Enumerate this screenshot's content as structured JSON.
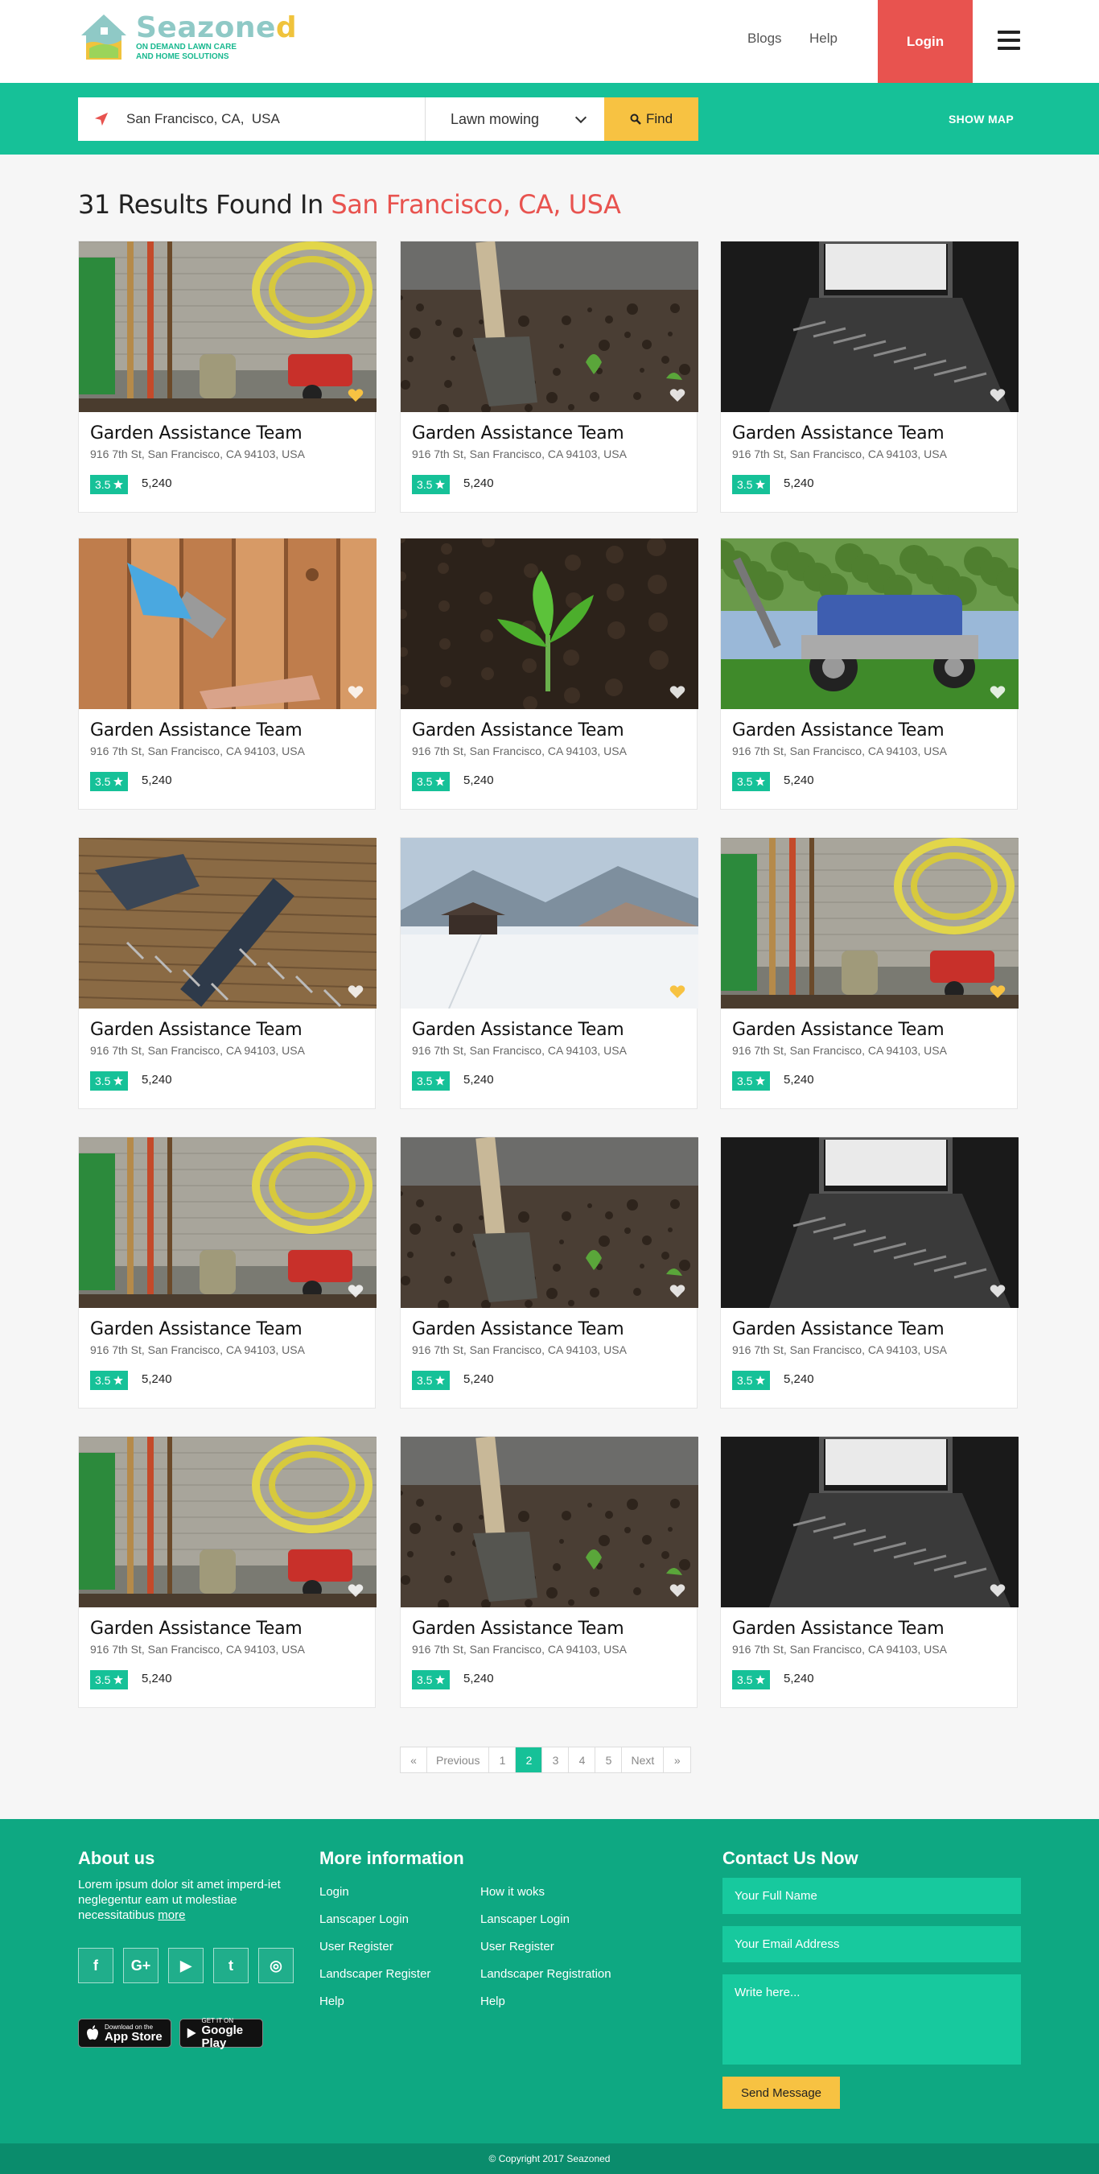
{
  "colors": {
    "brand": "#16c198",
    "accent_red": "#e8534f",
    "accent_yellow": "#f7c242",
    "footer_bg": "#0ea882"
  },
  "header": {
    "logo": {
      "name_main": "Seazone",
      "name_accent": "d",
      "tagline_1": "ON DEMAND LAWN CARE",
      "tagline_2": "AND HOME SOLUTIONS"
    },
    "nav": [
      "Blogs",
      "Help"
    ],
    "login_label": "Login",
    "menu_icon": "hamburger-icon"
  },
  "search": {
    "location_value": "San Francisco, CA,  USA",
    "location_icon": "location-arrow-icon",
    "service_value": "Lawn mowing",
    "find_label": "Find",
    "show_map_label": "SHOW MAP"
  },
  "results": {
    "prefix": "31 Results Found In",
    "city": "San Francisco, CA,  USA"
  },
  "cards": [
    {
      "title": "Garden Assistance Team",
      "address": "916 7th St, San Francisco, CA 94103, USA",
      "rating": "3.5",
      "reviews": "5,240",
      "image": "garden-tools",
      "favorite": true
    },
    {
      "title": "Garden Assistance Team",
      "address": "916 7th St, San Francisco, CA 94103, USA",
      "rating": "3.5",
      "reviews": "5,240",
      "image": "shovel-soil",
      "favorite": false
    },
    {
      "title": "Garden Assistance Team",
      "address": "916 7th St, San Francisco, CA 94103, USA",
      "rating": "3.5",
      "reviews": "5,240",
      "image": "dark-window-tools",
      "favorite": false
    },
    {
      "title": "Garden Assistance Team",
      "address": "916 7th St, San Francisco, CA 94103, USA",
      "rating": "3.5",
      "reviews": "5,240",
      "image": "paint-brush-wood",
      "favorite": false
    },
    {
      "title": "Garden Assistance Team",
      "address": "916 7th St, San Francisco, CA 94103, USA",
      "rating": "3.5",
      "reviews": "5,240",
      "image": "sprout-soil",
      "favorite": false
    },
    {
      "title": "Garden Assistance Team",
      "address": "916 7th St, San Francisco, CA 94103, USA",
      "rating": "3.5",
      "reviews": "5,240",
      "image": "lawn-mower",
      "favorite": false
    },
    {
      "title": "Garden Assistance Team",
      "address": "916 7th St, San Francisco, CA 94103, USA",
      "rating": "3.5",
      "reviews": "5,240",
      "image": "hammer-nails",
      "favorite": false
    },
    {
      "title": "Garden Assistance Team",
      "address": "916 7th St, San Francisco, CA 94103, USA",
      "rating": "3.5",
      "reviews": "5,240",
      "image": "snow-cabin",
      "favorite": true
    },
    {
      "title": "Garden Assistance Team",
      "address": "916 7th St, San Francisco, CA 94103, USA",
      "rating": "3.5",
      "reviews": "5,240",
      "image": "garden-tools",
      "favorite": true
    },
    {
      "title": "Garden Assistance Team",
      "address": "916 7th St, San Francisco, CA 94103, USA",
      "rating": "3.5",
      "reviews": "5,240",
      "image": "garden-tools",
      "favorite": false
    },
    {
      "title": "Garden Assistance Team",
      "address": "916 7th St, San Francisco, CA 94103, USA",
      "rating": "3.5",
      "reviews": "5,240",
      "image": "shovel-soil",
      "favorite": false
    },
    {
      "title": "Garden Assistance Team",
      "address": "916 7th St, San Francisco, CA 94103, USA",
      "rating": "3.5",
      "reviews": "5,240",
      "image": "dark-window-tools",
      "favorite": false
    },
    {
      "title": "Garden Assistance Team",
      "address": "916 7th St, San Francisco, CA 94103, USA",
      "rating": "3.5",
      "reviews": "5,240",
      "image": "garden-tools",
      "favorite": false
    },
    {
      "title": "Garden Assistance Team",
      "address": "916 7th St, San Francisco, CA 94103, USA",
      "rating": "3.5",
      "reviews": "5,240",
      "image": "shovel-soil",
      "favorite": false
    },
    {
      "title": "Garden Assistance Team",
      "address": "916 7th St, San Francisco, CA 94103, USA",
      "rating": "3.5",
      "reviews": "5,240",
      "image": "dark-window-tools",
      "favorite": false
    }
  ],
  "pagination": {
    "first": "«",
    "previous": "Previous",
    "pages": [
      "1",
      "2",
      "3",
      "4",
      "5"
    ],
    "current": "2",
    "next": "Next",
    "last": "»"
  },
  "footer": {
    "about": {
      "title": "About us",
      "text": "Lorem ipsum dolor sit amet imperd-iet neglegentur eam ut molestiae necessitatibus",
      "more": "more"
    },
    "social": [
      {
        "icon": "facebook-icon",
        "glyph": "f"
      },
      {
        "icon": "google-plus-icon",
        "glyph": "G+"
      },
      {
        "icon": "youtube-icon",
        "glyph": "▶"
      },
      {
        "icon": "twitter-icon",
        "glyph": "t"
      },
      {
        "icon": "instagram-icon",
        "glyph": "◎"
      }
    ],
    "app_store": {
      "small": "Download on the",
      "big": "App Store"
    },
    "google_play": {
      "small": "GET IT ON",
      "big": "Google Play"
    },
    "more_info": {
      "title": "More information",
      "col1": [
        "Login",
        "Lanscaper Login",
        "User Register",
        "Landscaper Register",
        "Help"
      ],
      "col2": [
        "How it woks",
        "Lanscaper Login",
        "User Register",
        "Landscaper Registration",
        "Help"
      ]
    },
    "contact": {
      "title": "Contact Us Now",
      "name_placeholder": "Your Full Name",
      "email_placeholder": "Your Email Address",
      "message_placeholder": "Write here...",
      "send_label": "Send Message"
    },
    "copyright": "© Copyright 2017 Seazoned"
  }
}
